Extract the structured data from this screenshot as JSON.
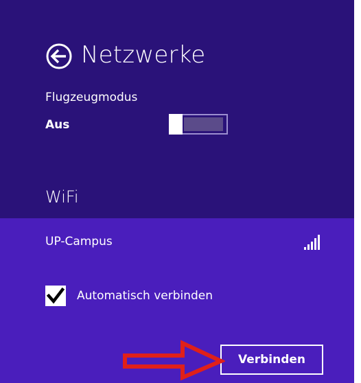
{
  "header": {
    "title": "Netzwerke",
    "back_icon": "back-arrow-circle-icon"
  },
  "airplane_mode": {
    "label": "Flugzeugmodus",
    "state_label": "Aus",
    "enabled": false
  },
  "wifi": {
    "heading": "WiFi",
    "networks": [
      {
        "name": "UP-Campus",
        "signal_icon": "signal-strength-icon",
        "auto_connect_label": "Automatisch verbinden",
        "auto_connect_checked": true,
        "connect_label": "Verbinden"
      }
    ]
  },
  "colors": {
    "header_background": "#2a1279",
    "selected_background": "#4a1ebc",
    "annotation_arrow": "#e0201a"
  }
}
